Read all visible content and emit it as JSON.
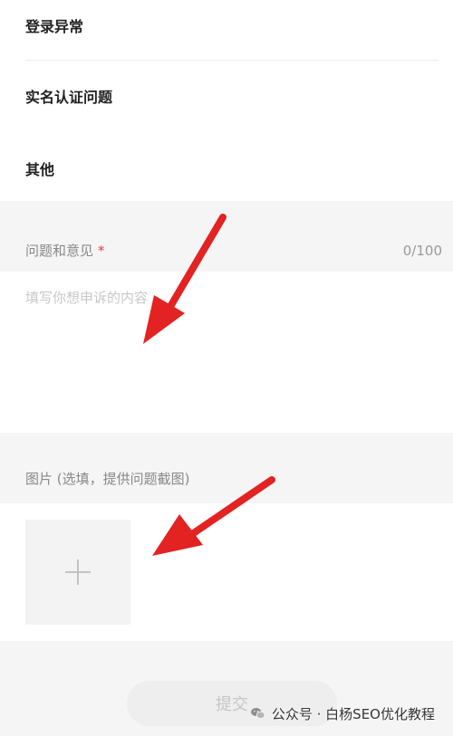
{
  "options": [
    {
      "label": "登录异常"
    },
    {
      "label": "实名认证问题"
    },
    {
      "label": "其他"
    }
  ],
  "feedback": {
    "title": "问题和意见",
    "required_mark": "*",
    "counter": "0/100",
    "placeholder": "填写你想申诉的内容"
  },
  "images": {
    "title": "图片 (选填，提供问题截图)",
    "add_icon": "plus-icon"
  },
  "submit": {
    "label": "提交"
  },
  "watermark": {
    "text": "公众号 · 白杨SEO优化教程",
    "icon": "wechat-icon"
  },
  "colors": {
    "required": "#e63b3b",
    "arrow": "#e32222",
    "background": "#f5f5f5"
  }
}
